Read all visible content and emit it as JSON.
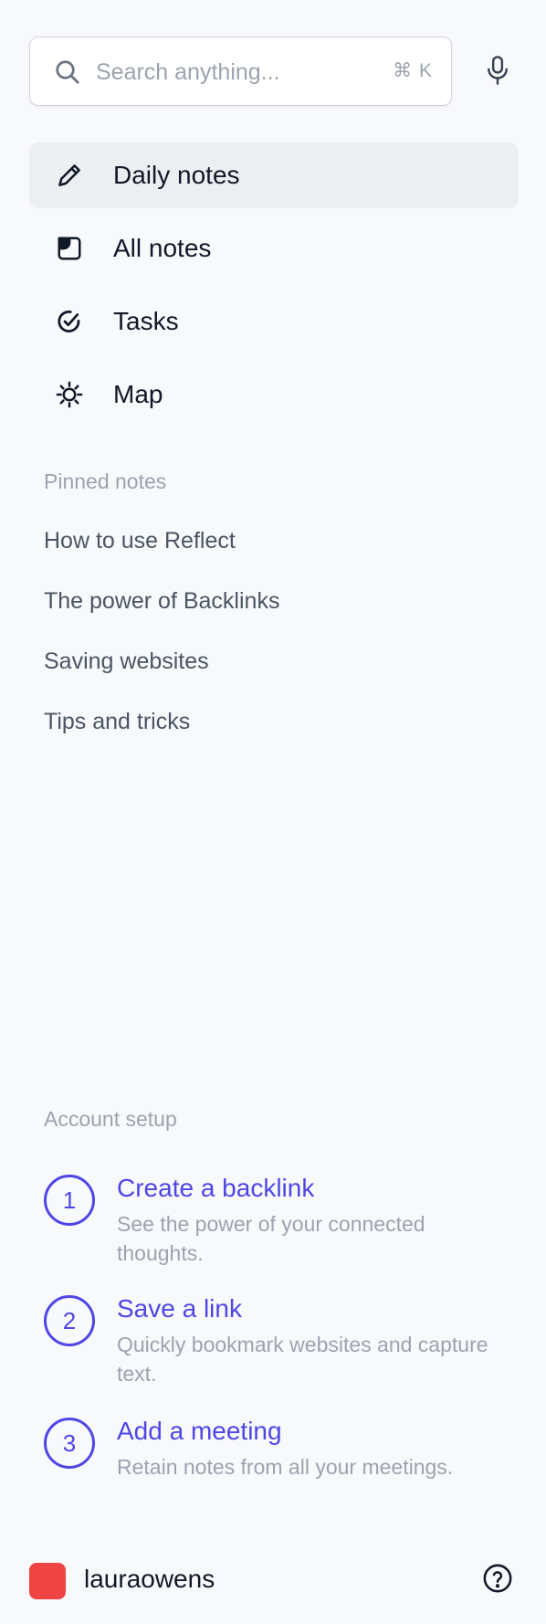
{
  "search": {
    "placeholder": "Search anything...",
    "shortcut": "⌘ K",
    "icon": "search-icon",
    "mic_icon": "microphone-icon"
  },
  "nav": {
    "items": [
      {
        "label": "Daily notes",
        "icon": "pencil-icon",
        "active": true
      },
      {
        "label": "All notes",
        "icon": "notes-icon",
        "active": false
      },
      {
        "label": "Tasks",
        "icon": "check-circle-icon",
        "active": false
      },
      {
        "label": "Map",
        "icon": "sun-icon",
        "active": false
      }
    ]
  },
  "pinned": {
    "title": "Pinned notes",
    "items": [
      "How to use Reflect",
      "The power of Backlinks",
      "Saving websites",
      "Tips and tricks"
    ]
  },
  "setup": {
    "title": "Account setup",
    "items": [
      {
        "number": "1",
        "title": "Create a backlink",
        "description": "See the power of your connected thoughts."
      },
      {
        "number": "2",
        "title": "Save a link",
        "description": "Quickly bookmark websites and capture text."
      },
      {
        "number": "3",
        "title": "Add a meeting",
        "description": "Retain notes from all your meetings."
      }
    ]
  },
  "footer": {
    "username": "lauraowens",
    "avatar_color": "#ef4444",
    "help_icon": "help-icon"
  },
  "colors": {
    "accent": "#4f46e5",
    "background": "#f8f9fb",
    "active_nav": "#eceef1"
  }
}
